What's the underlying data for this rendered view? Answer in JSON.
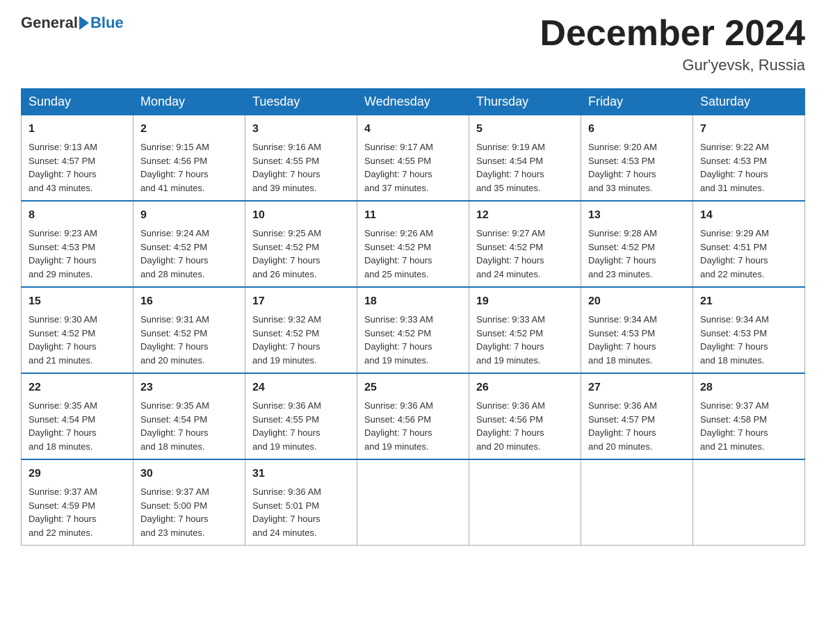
{
  "header": {
    "logo_general": "General",
    "logo_blue": "Blue",
    "month_title": "December 2024",
    "location": "Gur'yevsk, Russia"
  },
  "days_of_week": [
    "Sunday",
    "Monday",
    "Tuesday",
    "Wednesday",
    "Thursday",
    "Friday",
    "Saturday"
  ],
  "weeks": [
    [
      {
        "day": "1",
        "sunrise": "9:13 AM",
        "sunset": "4:57 PM",
        "daylight": "7 hours and 43 minutes."
      },
      {
        "day": "2",
        "sunrise": "9:15 AM",
        "sunset": "4:56 PM",
        "daylight": "7 hours and 41 minutes."
      },
      {
        "day": "3",
        "sunrise": "9:16 AM",
        "sunset": "4:55 PM",
        "daylight": "7 hours and 39 minutes."
      },
      {
        "day": "4",
        "sunrise": "9:17 AM",
        "sunset": "4:55 PM",
        "daylight": "7 hours and 37 minutes."
      },
      {
        "day": "5",
        "sunrise": "9:19 AM",
        "sunset": "4:54 PM",
        "daylight": "7 hours and 35 minutes."
      },
      {
        "day": "6",
        "sunrise": "9:20 AM",
        "sunset": "4:53 PM",
        "daylight": "7 hours and 33 minutes."
      },
      {
        "day": "7",
        "sunrise": "9:22 AM",
        "sunset": "4:53 PM",
        "daylight": "7 hours and 31 minutes."
      }
    ],
    [
      {
        "day": "8",
        "sunrise": "9:23 AM",
        "sunset": "4:53 PM",
        "daylight": "7 hours and 29 minutes."
      },
      {
        "day": "9",
        "sunrise": "9:24 AM",
        "sunset": "4:52 PM",
        "daylight": "7 hours and 28 minutes."
      },
      {
        "day": "10",
        "sunrise": "9:25 AM",
        "sunset": "4:52 PM",
        "daylight": "7 hours and 26 minutes."
      },
      {
        "day": "11",
        "sunrise": "9:26 AM",
        "sunset": "4:52 PM",
        "daylight": "7 hours and 25 minutes."
      },
      {
        "day": "12",
        "sunrise": "9:27 AM",
        "sunset": "4:52 PM",
        "daylight": "7 hours and 24 minutes."
      },
      {
        "day": "13",
        "sunrise": "9:28 AM",
        "sunset": "4:52 PM",
        "daylight": "7 hours and 23 minutes."
      },
      {
        "day": "14",
        "sunrise": "9:29 AM",
        "sunset": "4:51 PM",
        "daylight": "7 hours and 22 minutes."
      }
    ],
    [
      {
        "day": "15",
        "sunrise": "9:30 AM",
        "sunset": "4:52 PM",
        "daylight": "7 hours and 21 minutes."
      },
      {
        "day": "16",
        "sunrise": "9:31 AM",
        "sunset": "4:52 PM",
        "daylight": "7 hours and 20 minutes."
      },
      {
        "day": "17",
        "sunrise": "9:32 AM",
        "sunset": "4:52 PM",
        "daylight": "7 hours and 19 minutes."
      },
      {
        "day": "18",
        "sunrise": "9:33 AM",
        "sunset": "4:52 PM",
        "daylight": "7 hours and 19 minutes."
      },
      {
        "day": "19",
        "sunrise": "9:33 AM",
        "sunset": "4:52 PM",
        "daylight": "7 hours and 19 minutes."
      },
      {
        "day": "20",
        "sunrise": "9:34 AM",
        "sunset": "4:53 PM",
        "daylight": "7 hours and 18 minutes."
      },
      {
        "day": "21",
        "sunrise": "9:34 AM",
        "sunset": "4:53 PM",
        "daylight": "7 hours and 18 minutes."
      }
    ],
    [
      {
        "day": "22",
        "sunrise": "9:35 AM",
        "sunset": "4:54 PM",
        "daylight": "7 hours and 18 minutes."
      },
      {
        "day": "23",
        "sunrise": "9:35 AM",
        "sunset": "4:54 PM",
        "daylight": "7 hours and 18 minutes."
      },
      {
        "day": "24",
        "sunrise": "9:36 AM",
        "sunset": "4:55 PM",
        "daylight": "7 hours and 19 minutes."
      },
      {
        "day": "25",
        "sunrise": "9:36 AM",
        "sunset": "4:56 PM",
        "daylight": "7 hours and 19 minutes."
      },
      {
        "day": "26",
        "sunrise": "9:36 AM",
        "sunset": "4:56 PM",
        "daylight": "7 hours and 20 minutes."
      },
      {
        "day": "27",
        "sunrise": "9:36 AM",
        "sunset": "4:57 PM",
        "daylight": "7 hours and 20 minutes."
      },
      {
        "day": "28",
        "sunrise": "9:37 AM",
        "sunset": "4:58 PM",
        "daylight": "7 hours and 21 minutes."
      }
    ],
    [
      {
        "day": "29",
        "sunrise": "9:37 AM",
        "sunset": "4:59 PM",
        "daylight": "7 hours and 22 minutes."
      },
      {
        "day": "30",
        "sunrise": "9:37 AM",
        "sunset": "5:00 PM",
        "daylight": "7 hours and 23 minutes."
      },
      {
        "day": "31",
        "sunrise": "9:36 AM",
        "sunset": "5:01 PM",
        "daylight": "7 hours and 24 minutes."
      },
      null,
      null,
      null,
      null
    ]
  ]
}
